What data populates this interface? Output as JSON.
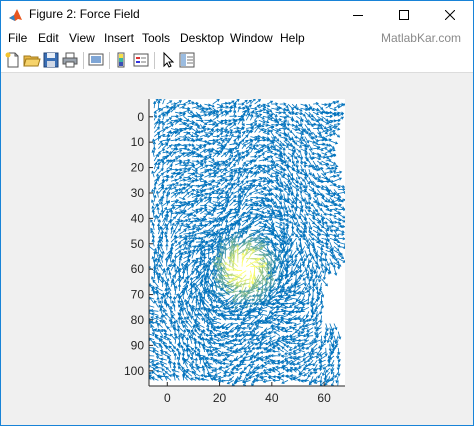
{
  "window": {
    "title": "Figure 2: Force Field",
    "controls": [
      "minimize",
      "maximize",
      "close"
    ]
  },
  "menu": {
    "items": [
      "File",
      "Edit",
      "View",
      "Insert",
      "Tools",
      "Desktop",
      "Window",
      "Help"
    ],
    "watermark": "MatlabKar.com"
  },
  "toolbar": {
    "buttons": [
      "new-figure-icon",
      "open-file-icon",
      "save-icon",
      "print-icon",
      "link-figure-icon",
      "insert-colorbar-icon",
      "insert-legend-icon",
      "edit-plot-arrow-icon",
      "property-inspector-icon"
    ]
  },
  "colors": {
    "window_border": "#1883d7",
    "arrow_blue": "#0072bd",
    "arrow_highlight": "#ffff66",
    "figure_background": "#f0f0f0"
  },
  "chart_data": {
    "type": "quiver",
    "title": "",
    "xlabel": "",
    "ylabel": "",
    "x_ticks": [
      0,
      20,
      40,
      60
    ],
    "y_ticks": [
      0,
      10,
      20,
      30,
      40,
      50,
      60,
      70,
      80,
      90,
      100
    ],
    "xlim": [
      -7,
      68
    ],
    "ylim": [
      -7,
      106
    ],
    "y_direction": "reverse",
    "grid": false,
    "legend": "none",
    "description_fields": {
      "field_extent_x": [
        -5,
        66
      ],
      "field_extent_y": [
        -5,
        104
      ],
      "high_magnitude_center": [
        30,
        60
      ]
    }
  }
}
